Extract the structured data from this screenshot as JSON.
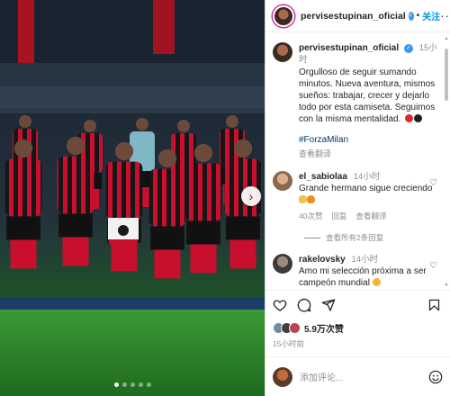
{
  "post": {
    "carousel": {
      "slide_count": 5,
      "active_index": 0
    }
  },
  "header": {
    "username": "pervisestupinan_oficial",
    "separator": "•",
    "follow_label": "关注",
    "more_label": "···"
  },
  "caption": {
    "username": "pervisestupinan_oficial",
    "time": "15小时",
    "text": "Orgulloso de seguir sumando minutos. Nueva aventura, mismos sueños: trabajar, crecer y dejarlo todo por esta camiseta. Seguimos con la misma mentalidad.",
    "hashtag": "#ForzaMilan",
    "translate": "查看翻译"
  },
  "comments": [
    {
      "username": "el_sabiolaa",
      "time": "14小时",
      "text": "Grande hermano sigue creciendo",
      "likes": "40次赞",
      "reply": "回复",
      "translate": "查看翻译",
      "view_replies": "查看所有2条回复"
    },
    {
      "username": "rakelovsky",
      "time": "14小时",
      "text": "Amo mi selección próxima a ser campeón mundial"
    }
  ],
  "actions": {
    "like_count": "5.9万次赞",
    "posted_time": "15小时前"
  },
  "add_comment": {
    "placeholder": "添加评论..."
  },
  "colors": {
    "accent": "#0095f6",
    "milan_red": "#c8102e",
    "pitch": "#2f8a2c"
  }
}
